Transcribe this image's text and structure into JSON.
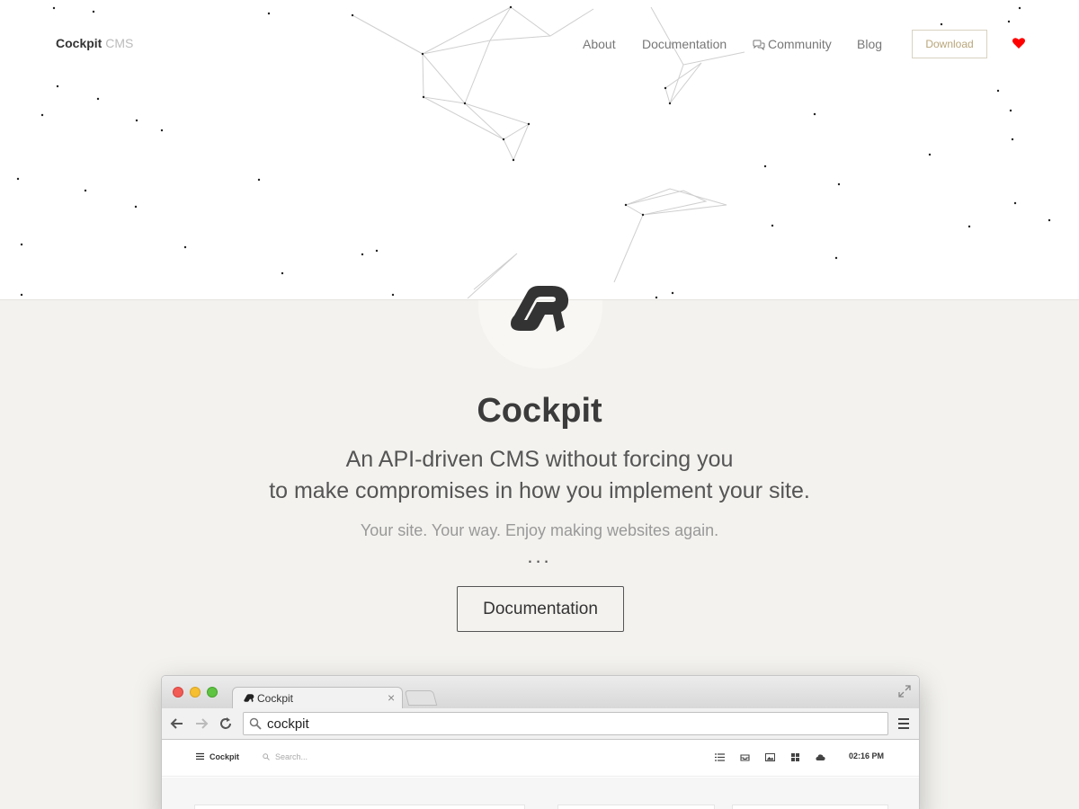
{
  "header": {
    "brand_main": "Cockpit",
    "brand_sub": "CMS",
    "nav": {
      "about": "About",
      "documentation": "Documentation",
      "community": "Community",
      "blog": "Blog"
    },
    "download_label": "Download",
    "icons": {
      "community": "chat-bubbles-icon",
      "support": "heart-icon"
    },
    "colors": {
      "heart": "#ff0000",
      "download_text": "#b9a67a"
    }
  },
  "hero": {
    "title": "Cockpit",
    "tagline_line1": "An API-driven CMS without forcing you",
    "tagline_line2": "to make compromises in how you implement your site.",
    "subtagline": "Your site. Your way. Enjoy making websites again.",
    "dots": "...",
    "docs_button": "Documentation"
  },
  "browser": {
    "tab_title": "Cockpit",
    "tab_close": "×",
    "address": "cockpit",
    "app": {
      "brand": "Cockpit",
      "search_placeholder": "Search...",
      "time": "02:16 PM",
      "icons": [
        "list-icon",
        "inbox-icon",
        "image-icon",
        "grid-icon",
        "cloud-icon"
      ]
    }
  }
}
